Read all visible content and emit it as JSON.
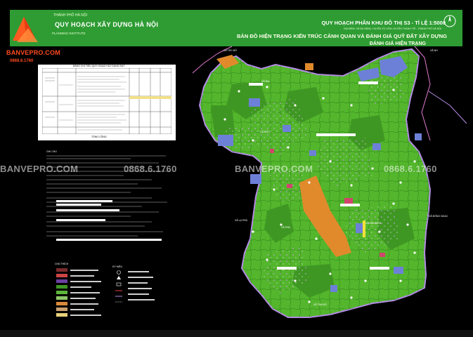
{
  "header": {
    "org_small": "THÀNH PHỐ HÀ NỘI",
    "org_name": "QUY HOẠCH XÂY DỰNG HÀ NỘI",
    "org_sub": "PLANNING INSTITUTE ",
    "title_main": "QUY HOẠCH PHÂN KHU ĐÔ THỊ S3 - TỈ LỆ 1:5000",
    "title_loc": "ĐỊA ĐIỂM: XÃ ĐÀ NẴNG, HUYỆN TỪ LIÊM, HUYỆN THANH TRÌ - THÀNH PHỐ HÀ NỘI",
    "title_sub": "BẢN ĐỒ HIỆN TRẠNG KIẾN TRÚC CẢNH QUAN VÀ ĐÁNH GIÁ QUỸ ĐẤT XÂY DỰNG",
    "title_sub2": "ĐÁNH GIÁ HIỆN TRẠNG"
  },
  "logo": {
    "brand": "BANVEPRO.COM",
    "phone": "0868.6.1760"
  },
  "table": {
    "title": "BẢNG CHỈ TIÊU QUY HOẠCH SỬ DỤNG ĐẤT",
    "footer": "TỔNG CỘNG"
  },
  "notes": {
    "heading": "GHI CHÚ"
  },
  "legend": {
    "title": "CHÚ THÍCH",
    "title2": "KÝ HIỆU"
  },
  "watermarks": [
    {
      "text": "BANVEPRO.COM"
    },
    {
      "text": "0868.6.1760"
    },
    {
      "text": "BANVEPRO.COM"
    },
    {
      "text": "0868.6.1760"
    }
  ],
  "map_labels": [
    {
      "text": "XÃ NH"
    },
    {
      "text": "XÃ TÂY MỖ"
    },
    {
      "text": "XÃ ĐẠI"
    },
    {
      "text": "XÃ HỮU"
    },
    {
      "text": "XÃ LA PHÙ"
    },
    {
      "text": "XÃ PHÚ"
    },
    {
      "text": "XÃ TÂN ĐỒ"
    },
    {
      "text": "XÃ ĐÔNG NGẠC"
    },
    {
      "text": "XÃ VĂN ĐIỂN"
    }
  ],
  "colors": {
    "header_bg": "#2e9c33",
    "map_green": "#53b62c",
    "map_green_dark": "#3f9723",
    "map_blue": "#6d80d8",
    "map_orange": "#e08a2c",
    "road_purple": "#b48ce6",
    "brand_red": "#ff4a1e"
  }
}
